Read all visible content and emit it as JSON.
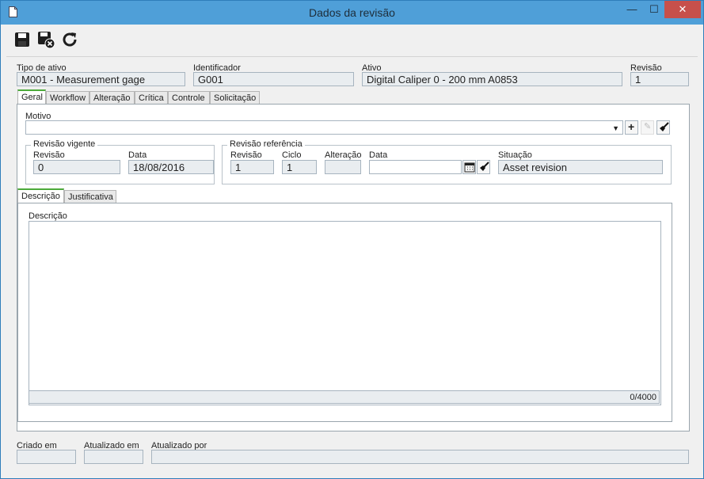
{
  "window": {
    "title": "Dados da revisão"
  },
  "toolbar": {
    "icons": [
      "save-icon",
      "save-close-icon",
      "refresh-icon"
    ]
  },
  "header": {
    "tipo_label": "Tipo de ativo",
    "tipo_value": "M001 - Measurement gage",
    "ident_label": "Identificador",
    "ident_value": "G001",
    "ativo_label": "Ativo",
    "ativo_value": "Digital Caliper 0 - 200 mm A0853",
    "revisao_label": "Revisão",
    "revisao_value": "1"
  },
  "tabs": [
    "Geral",
    "Workflow",
    "Alteração",
    "Crítica",
    "Controle",
    "Solicitação"
  ],
  "geral": {
    "motivo_label": "Motivo",
    "vigente": {
      "legend": "Revisão vigente",
      "revisao_label": "Revisão",
      "revisao_value": "0",
      "data_label": "Data",
      "data_value": "18/08/2016"
    },
    "referencia": {
      "legend": "Revisão referência",
      "revisao_label": "Revisão",
      "revisao_value": "1",
      "ciclo_label": "Ciclo",
      "ciclo_value": "1",
      "alteracao_label": "Alteração",
      "alteracao_value": "",
      "data_label": "Data",
      "data_value": "",
      "situacao_label": "Situação",
      "situacao_value": "Asset revision"
    },
    "subtabs": [
      "Descrição",
      "Justificativa"
    ],
    "descricao_label": "Descrição",
    "counter": "0/4000"
  },
  "footer": {
    "criado_label": "Criado em",
    "atualizado_label": "Atualizado em",
    "atualizado_por_label": "Atualizado por"
  }
}
